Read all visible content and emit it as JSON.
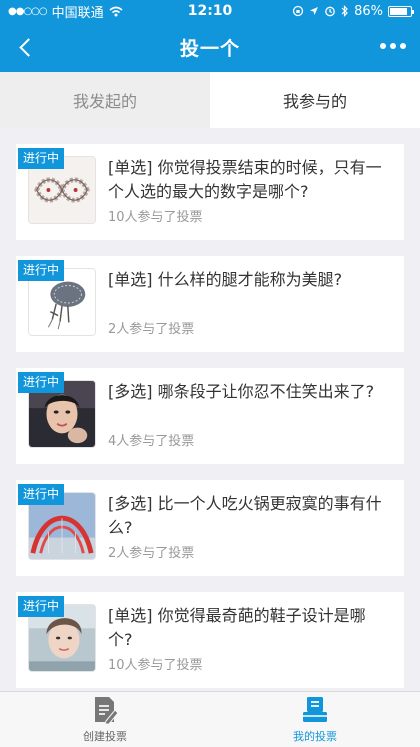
{
  "status_bar": {
    "carrier": "中国联通",
    "time": "12:10",
    "battery": "86%"
  },
  "nav": {
    "title": "投一个",
    "back_icon": "chevron-left-icon",
    "more_icon": "more-dots-icon"
  },
  "tabs": [
    {
      "label": "我发起的",
      "active": false
    },
    {
      "label": "我参与的",
      "active": true
    }
  ],
  "polls": [
    {
      "status": "进行中",
      "title": "[单选] 你觉得投票结束的时候，只有一个人选的最大的数字是哪个?",
      "participants": "10人参与了投票",
      "thumb": "infinity-bracelet-photo"
    },
    {
      "status": "进行中",
      "title": "[单选] 什么样的腿才能称为美腿?",
      "participants": "2人参与了投票",
      "thumb": "sketch-drawing-photo"
    },
    {
      "status": "进行中",
      "title": "[多选] 哪条段子让你忍不住笑出来了?",
      "participants": "4人参与了投票",
      "thumb": "woman-portrait-photo"
    },
    {
      "status": "进行中",
      "title": "[多选] 比一个人吃火锅更寂寞的事有什么?",
      "participants": "2人参与了投票",
      "thumb": "red-bridge-photo"
    },
    {
      "status": "进行中",
      "title": "[单选] 你觉得最奇葩的鞋子设计是哪个?",
      "participants": "10人参与了投票",
      "thumb": "selfie-photo"
    }
  ],
  "tabbar": [
    {
      "label": "创建投票",
      "icon": "create-poll-icon",
      "active": false
    },
    {
      "label": "我的投票",
      "icon": "my-polls-icon",
      "active": true
    }
  ],
  "colors": {
    "primary": "#1296db",
    "background": "#efeff4",
    "muted_text": "#999999"
  }
}
